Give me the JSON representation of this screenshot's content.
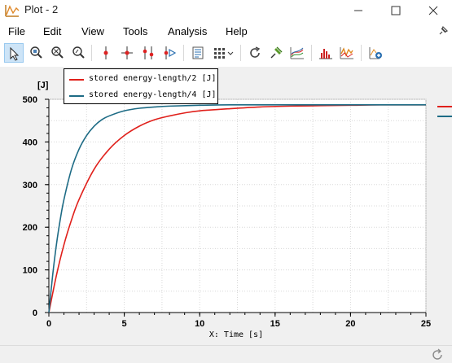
{
  "window": {
    "title": "Plot - 2",
    "minimize_icon": "minimize-icon",
    "maximize_icon": "maximize-icon",
    "close_icon": "close-icon"
  },
  "menu": {
    "items": [
      {
        "label": "File",
        "key": "file"
      },
      {
        "label": "Edit",
        "key": "edit"
      },
      {
        "label": "View",
        "key": "view"
      },
      {
        "label": "Tools",
        "key": "tools"
      },
      {
        "label": "Analysis",
        "key": "analysis"
      },
      {
        "label": "Help",
        "key": "help"
      }
    ]
  },
  "toolbar": {
    "icons": [
      "select-arrow-icon",
      "zoom-region-icon",
      "zoom-in-icon",
      "zoom-out-icon",
      "marker-icon",
      "cross-marker-icon",
      "double-marker-icon",
      "marker-play-icon",
      "data-table-icon",
      "grid-layout-icon",
      "reset-icon",
      "pin-icon",
      "curves-icon",
      "histogram-icon",
      "spectrum-icon",
      "add-plot-icon"
    ]
  },
  "chart_data": {
    "type": "line",
    "xlabel": "X: Time [s]",
    "ylabel": "[J]",
    "xlim": [
      0,
      25
    ],
    "ylim": [
      0,
      500
    ],
    "xticks": [
      0,
      5,
      10,
      15,
      20,
      25
    ],
    "yticks": [
      0,
      100,
      200,
      300,
      400,
      500
    ],
    "grid": true,
    "legend_position": "top-left",
    "series": [
      {
        "name": "stored energy-length/2 [J]",
        "color": "#e0201b",
        "x": [
          0,
          0.5,
          1,
          1.5,
          2,
          3,
          4,
          5,
          6,
          7,
          8,
          9,
          10,
          12,
          14,
          16,
          18,
          20,
          22,
          25
        ],
        "y": [
          0,
          87,
          159,
          217,
          265,
          336,
          383,
          415,
          437,
          452,
          461,
          468,
          473,
          478,
          482,
          484,
          485,
          486,
          487,
          487
        ]
      },
      {
        "name": "stored energy-length/4 [J]",
        "color": "#1d6b85",
        "x": [
          0,
          0.25,
          0.5,
          0.75,
          1,
          1.5,
          2,
          2.5,
          3,
          3.5,
          4,
          5,
          6,
          7,
          8,
          10,
          12,
          15,
          20,
          25
        ],
        "y": [
          0,
          87,
          159,
          217,
          265,
          336,
          383,
          415,
          437,
          452,
          461,
          473,
          479,
          482,
          484,
          486,
          487,
          487,
          487,
          487
        ]
      }
    ]
  },
  "colors": {
    "accent": "#0078d7"
  }
}
